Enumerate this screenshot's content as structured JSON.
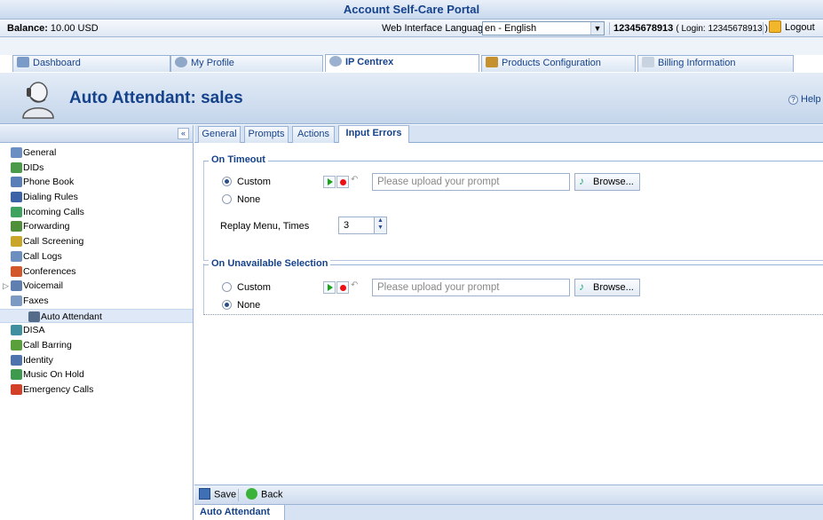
{
  "portal": {
    "title": "Account Self-Care Portal"
  },
  "infobar": {
    "balance_label": "Balance:",
    "balance_value": "10.00 USD",
    "language_label": "Web Interface Language:",
    "language_value": "en - English",
    "account_number": "12345678913",
    "login_text": "( Login: 12345678913 )",
    "logout_label": "Logout"
  },
  "main_tabs": [
    {
      "label": "Dashboard"
    },
    {
      "label": "My Profile"
    },
    {
      "label": "IP Centrex"
    },
    {
      "label": "Products Configuration"
    },
    {
      "label": "Billing Information"
    }
  ],
  "header": {
    "title": "Auto Attendant: sales",
    "help_label": "Help"
  },
  "sidebar": {
    "collapse_glyph": "«",
    "items": [
      {
        "label": "General",
        "icon": "gear-icon",
        "color": "#6b8fc2"
      },
      {
        "label": "DIDs",
        "icon": "dids-icon",
        "color": "#4a9a4a"
      },
      {
        "label": "Phone Book",
        "icon": "phone-book-icon",
        "color": "#5a7fb8"
      },
      {
        "label": "Dialing Rules",
        "icon": "dialing-rules-icon",
        "color": "#3c63a5"
      },
      {
        "label": "Incoming Calls",
        "icon": "incoming-calls-icon",
        "color": "#3fa35f"
      },
      {
        "label": "Forwarding",
        "icon": "forwarding-icon",
        "color": "#4f8f3a"
      },
      {
        "label": "Call Screening",
        "icon": "call-screening-icon",
        "color": "#c9a52a"
      },
      {
        "label": "Call Logs",
        "icon": "call-logs-icon",
        "color": "#6c8fbf"
      },
      {
        "label": "Conferences",
        "icon": "conferences-icon",
        "color": "#d2572a"
      },
      {
        "label": "Voicemail",
        "icon": "voicemail-icon",
        "color": "#5e7fb0"
      },
      {
        "label": "Faxes",
        "icon": "faxes-icon",
        "color": "#7d9ac2"
      },
      {
        "label": "Auto Attendant",
        "icon": "auto-attendant-icon",
        "color": "#556b8a"
      },
      {
        "label": "DISA",
        "icon": "disa-icon",
        "color": "#3f8f9f"
      },
      {
        "label": "Call Barring",
        "icon": "call-barring-icon",
        "color": "#5aa03a"
      },
      {
        "label": "Identity",
        "icon": "identity-icon",
        "color": "#4f74ad"
      },
      {
        "label": "Music On Hold",
        "icon": "music-on-hold-icon",
        "color": "#3f9a4f"
      },
      {
        "label": "Emergency Calls",
        "icon": "emergency-calls-icon",
        "color": "#d2402a"
      }
    ]
  },
  "subtabs": [
    {
      "label": "General"
    },
    {
      "label": "Prompts"
    },
    {
      "label": "Actions"
    },
    {
      "label": "Input Errors"
    }
  ],
  "on_timeout": {
    "legend": "On Timeout",
    "custom_label": "Custom",
    "none_label": "None",
    "selected": "Custom",
    "prompt_placeholder": "Please upload your prompt",
    "browse_label": "Browse...",
    "replay_label": "Replay Menu, Times",
    "replay_value": "3"
  },
  "on_unavailable": {
    "legend": "On Unavailable Selection",
    "custom_label": "Custom",
    "none_label": "None",
    "selected": "None",
    "prompt_placeholder": "Please upload your prompt",
    "browse_label": "Browse..."
  },
  "bottom": {
    "save_label": "Save",
    "back_label": "Back",
    "footer_tab": "Auto Attendant"
  }
}
